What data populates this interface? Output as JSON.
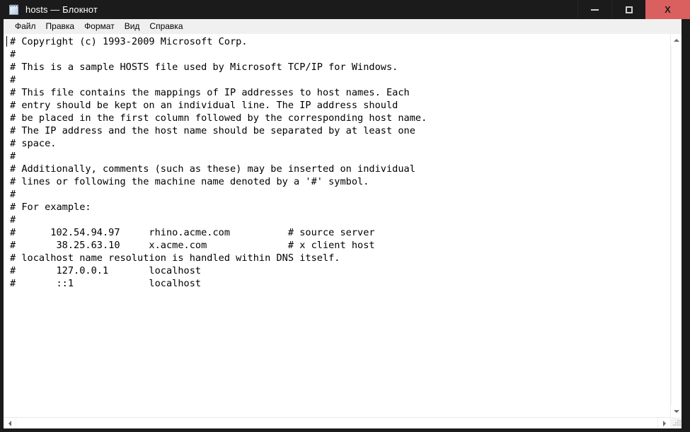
{
  "window": {
    "title": "hosts — Блокнот",
    "app_icon": "notepad-icon",
    "frame_color": "#1b1b1b",
    "close_button_color": "#d9605e"
  },
  "titlebar": {
    "minimize_label": "",
    "maximize_label": "",
    "close_label": "X"
  },
  "menubar": {
    "items": [
      {
        "label": "Файл"
      },
      {
        "label": "Правка"
      },
      {
        "label": "Формат"
      },
      {
        "label": "Вид"
      },
      {
        "label": "Справка"
      }
    ]
  },
  "editor": {
    "font": "monospace",
    "caret_line": 0,
    "caret_column": 0,
    "lines": [
      "# Copyright (c) 1993-2009 Microsoft Corp.",
      "#",
      "# This is a sample HOSTS file used by Microsoft TCP/IP for Windows.",
      "#",
      "# This file contains the mappings of IP addresses to host names. Each",
      "# entry should be kept on an individual line. The IP address should",
      "# be placed in the first column followed by the corresponding host name.",
      "# The IP address and the host name should be separated by at least one",
      "# space.",
      "#",
      "# Additionally, comments (such as these) may be inserted on individual",
      "# lines or following the machine name denoted by a '#' symbol.",
      "#",
      "# For example:",
      "#",
      "#      102.54.94.97     rhino.acme.com          # source server",
      "#       38.25.63.10     x.acme.com              # x client host",
      "# localhost name resolution is handled within DNS itself.",
      "#       127.0.0.1       localhost",
      "#       ::1             localhost"
    ]
  },
  "scrollbars": {
    "vertical": {
      "up_arrow": "chevron-up-icon",
      "down_arrow": "chevron-down-icon",
      "thumb_visible": false
    },
    "horizontal": {
      "left_arrow": "chevron-left-icon",
      "right_arrow": "chevron-right-icon",
      "thumb_visible": false
    },
    "resize_grip": "resize-grip-icon"
  }
}
